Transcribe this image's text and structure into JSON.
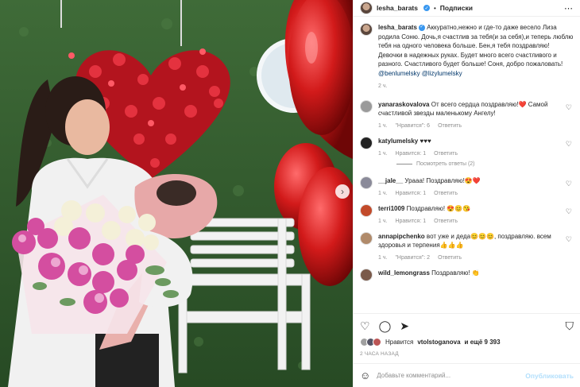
{
  "post": {
    "username": "lesha_barats",
    "follow_label": "Подписки",
    "caption_user": "lesha_barats",
    "caption_text": "Аккуратно,нежно и где-то даже весело Лиза родила Соню. Дочь,я счастлив за тебя(и за себя),и теперь люблю тебя на одного человека больше. Бен,я тебя поздравляю! Девочки в надежных руках. Будет много всего счастливого и разного. Счастливого будет больше! Соня, добро пожаловать!",
    "caption_mentions": "@benlumelsky @lizylumelsky",
    "caption_time": "2 ч."
  },
  "comments": [
    {
      "user": "yanaraskovalova",
      "text": "От всего сердца поздравляю!❤️ Самой счастливой звезды маленькому Ангелу!",
      "time": "1 ч.",
      "likes": "\"Нравится\": 6",
      "reply": "Ответить",
      "avatar": "#9a9a9a"
    },
    {
      "user": "katylumelsky",
      "text": "♥♥♥",
      "time": "1 ч.",
      "likes": "Нравится: 1",
      "reply": "Ответить",
      "avatar": "#222222"
    },
    {
      "user": "__jale__",
      "text": "Урааа! Поздравляю!😍❤️",
      "time": "1 ч.",
      "likes": "Нравится: 1",
      "reply": "Ответить",
      "avatar": "#8a8a99"
    },
    {
      "user": "terri1009",
      "text": "Поздравляю! 😍😊😘",
      "time": "1 ч.",
      "likes": "Нравится: 1",
      "reply": "Ответить",
      "avatar": "#c24a2a"
    },
    {
      "user": "annapipchenko",
      "text": "вот уже и деда😊😊😊, поздравляю. всем здоровья и терпения👍👍👍",
      "time": "1 ч.",
      "likes": "\"Нравится\": 2",
      "reply": "Ответить",
      "avatar": "#b08a6a"
    },
    {
      "user": "wild_lemongrass",
      "text": "Поздравляю! 👏",
      "time": "",
      "likes": "",
      "reply": "",
      "avatar": "#7a5a4a"
    }
  ],
  "replies_label": "Посмотреть ответы (2)",
  "likes": {
    "prefix": "Нравится",
    "user": "vtolstoganova",
    "suffix": "и ещё 9 393"
  },
  "time_ago": "2 ЧАСА НАЗАД",
  "add_comment": {
    "placeholder": "Добавьте комментарий...",
    "publish_label": "Опубликовать"
  },
  "colors": {
    "link": "#00376b",
    "secondary": "#8e8e8e",
    "publish_disabled": "#b2dffc",
    "verified": "#3897f0"
  }
}
